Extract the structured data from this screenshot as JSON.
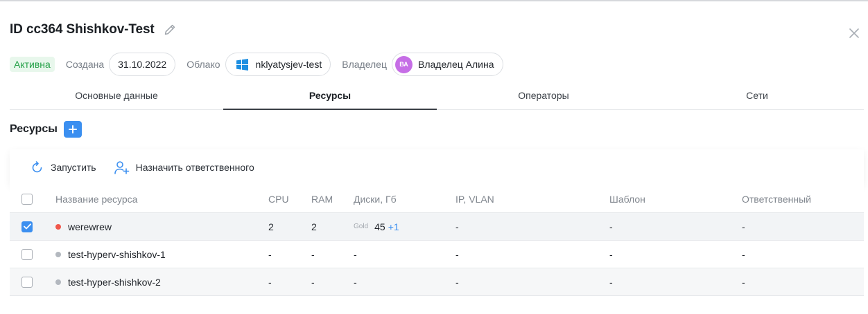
{
  "header": {
    "title": "ID cc364 Shishkov-Test",
    "edit_icon": "pencil-icon",
    "close_icon": "close-icon"
  },
  "meta": {
    "status": "Активна",
    "created_label": "Создана",
    "created_value": "31.10.2022",
    "cloud_label": "Облако",
    "cloud_value": "nklyatysjev-test",
    "cloud_icon": "windows-icon",
    "owner_label": "Владелец",
    "owner_initials": "ВА",
    "owner_name": "Владелец Алина"
  },
  "tabs": [
    {
      "label": "Основные данные",
      "active": false
    },
    {
      "label": "Ресурсы",
      "active": true
    },
    {
      "label": "Операторы",
      "active": false
    },
    {
      "label": "Сети",
      "active": false
    }
  ],
  "section": {
    "title": "Ресурсы",
    "add_icon": "plus-icon"
  },
  "toolbar": {
    "start_label": "Запустить",
    "assign_label": "Назначить ответственного"
  },
  "table": {
    "columns": {
      "name": "Название ресурса",
      "cpu": "CPU",
      "ram": "RAM",
      "disks": "Диски, Гб",
      "ip": "IP, VLAN",
      "template": "Шаблон",
      "responsible": "Ответственный"
    },
    "rows": [
      {
        "checked": true,
        "status_color": "#f0574b",
        "name": "werewrew",
        "cpu": "2",
        "ram": "2",
        "disk_tier": "Gold",
        "disk_value": "45",
        "disk_extra": "+1",
        "disks": "",
        "ip": "-",
        "template": "-",
        "responsible": "-"
      },
      {
        "checked": false,
        "status_color": "#b3b8bf",
        "name": "test-hyperv-shishkov-1",
        "cpu": "-",
        "ram": "-",
        "disk_tier": "",
        "disk_value": "",
        "disk_extra": "",
        "disks": "-",
        "ip": "-",
        "template": "-",
        "responsible": "-"
      },
      {
        "checked": false,
        "status_color": "#b3b8bf",
        "name": "test-hyper-shishkov-2",
        "cpu": "-",
        "ram": "-",
        "disk_tier": "",
        "disk_value": "",
        "disk_extra": "",
        "disks": "-",
        "ip": "-",
        "template": "-",
        "responsible": "-"
      }
    ]
  },
  "colors": {
    "accent": "#3b8ff0",
    "status_active_bg": "#e8f7ec",
    "status_active_text": "#23a047",
    "avatar_bg": "#c66ee6"
  }
}
